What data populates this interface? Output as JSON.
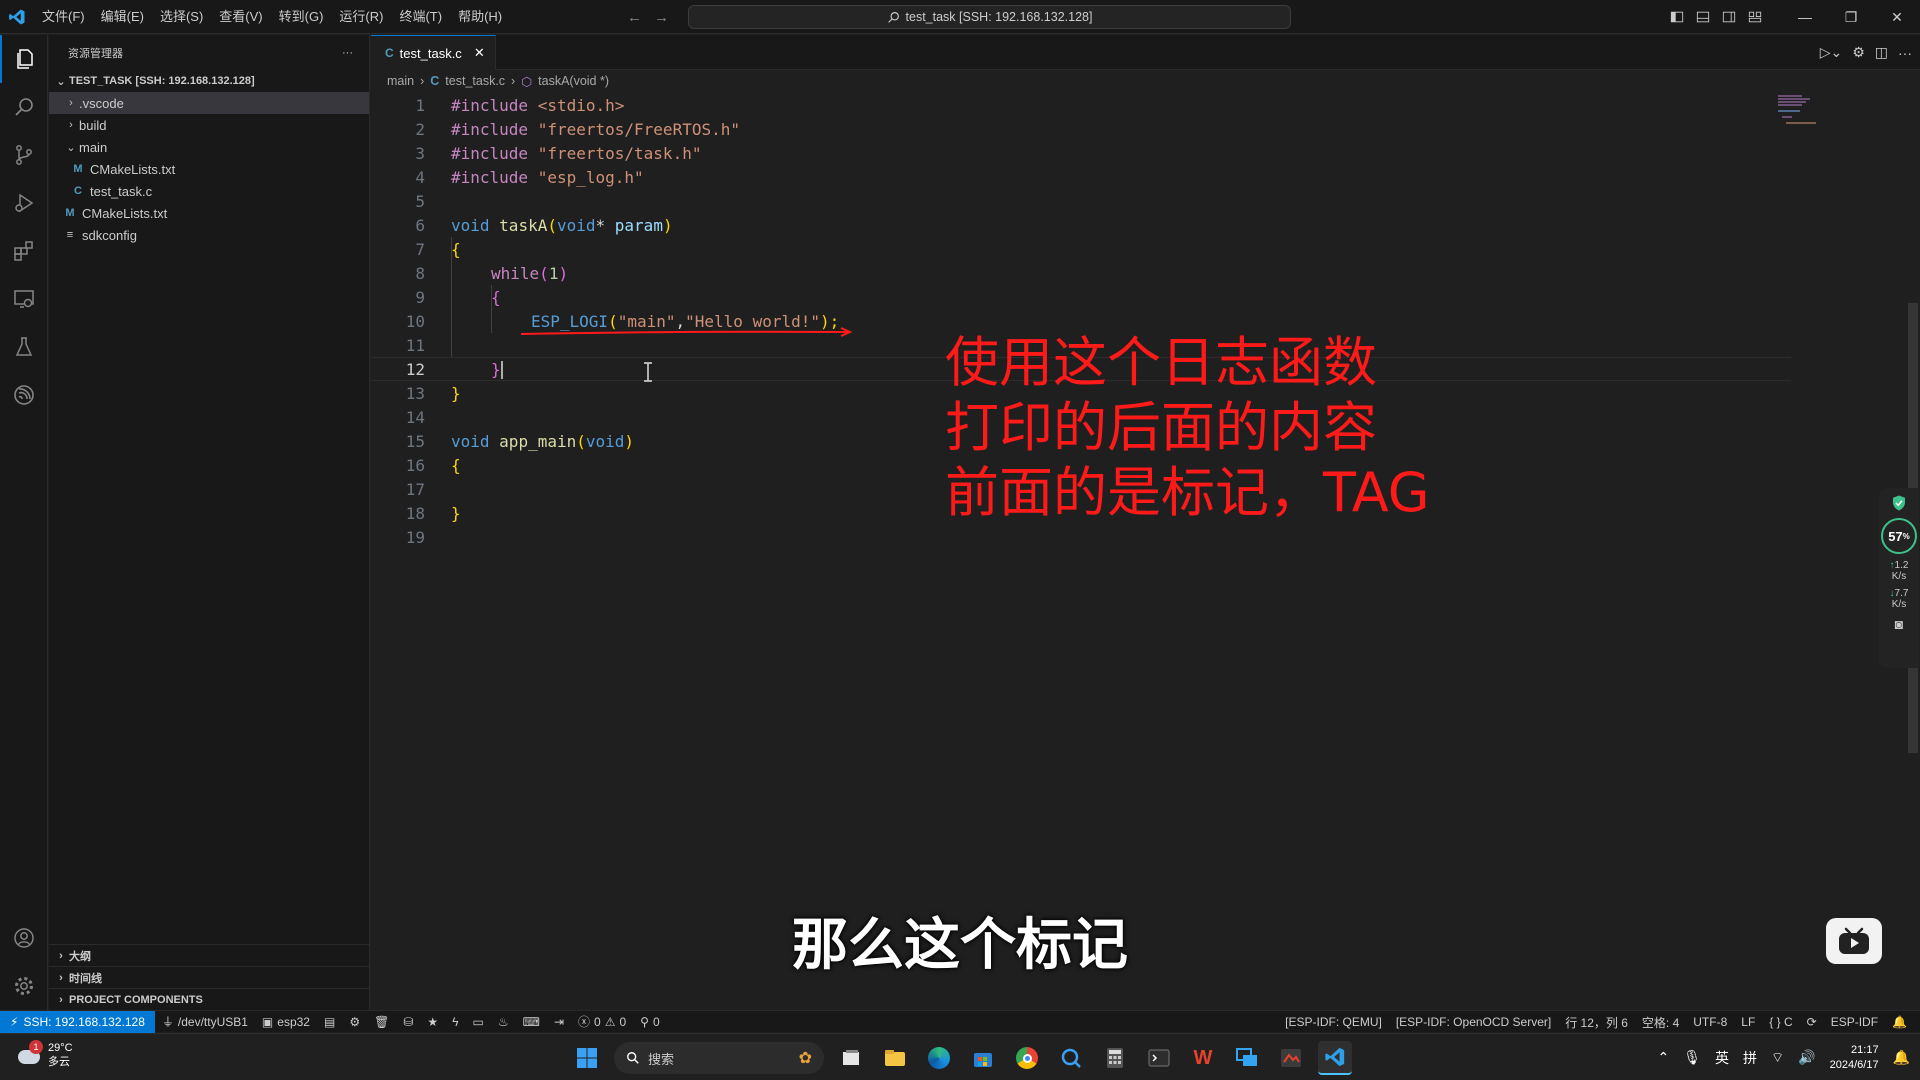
{
  "titlebar": {
    "menu": [
      "文件(F)",
      "编辑(E)",
      "选择(S)",
      "查看(V)",
      "转到(G)",
      "运行(R)",
      "终端(T)",
      "帮助(H)"
    ],
    "command_center": "test_task [SSH: 192.168.132.128]"
  },
  "sidebar": {
    "title": "资源管理器",
    "workspace": "TEST_TASK [SSH: 192.168.132.128]",
    "items": [
      {
        "label": ".vscode",
        "type": "folder"
      },
      {
        "label": "build",
        "type": "folder"
      },
      {
        "label": "main",
        "type": "folder-open"
      },
      {
        "label": "CMakeLists.txt",
        "type": "cmake"
      },
      {
        "label": "test_task.c",
        "type": "c"
      },
      {
        "label": "CMakeLists.txt",
        "type": "cmake"
      },
      {
        "label": "sdkconfig",
        "type": "config"
      }
    ],
    "bottom_sections": [
      "大纲",
      "时间线",
      "PROJECT COMPONENTS"
    ]
  },
  "editor": {
    "tab": "test_task.c",
    "breadcrumb": [
      "main",
      "test_task.c",
      "taskA(void *)"
    ],
    "line_numbers": [
      "1",
      "2",
      "3",
      "4",
      "5",
      "6",
      "7",
      "8",
      "9",
      "10",
      "11",
      "12",
      "13",
      "14",
      "15",
      "16",
      "17",
      "18",
      "19"
    ],
    "current_line": "12",
    "code": {
      "l1": [
        "#include",
        " ",
        "<stdio.h>"
      ],
      "l2": [
        "#include",
        " ",
        "\"freertos/FreeRTOS.h\""
      ],
      "l3": [
        "#include",
        " ",
        "\"freertos/task.h\""
      ],
      "l4": [
        "#include",
        " ",
        "\"esp_log.h\""
      ],
      "l6": [
        "void",
        " ",
        "taskA",
        "(",
        "void",
        "* ",
        "param",
        ")"
      ],
      "l7": "{",
      "l8": [
        "while",
        "(",
        "1",
        ")"
      ],
      "l9": "{",
      "l10": [
        "ESP_LOGI",
        "(",
        "\"main\"",
        ",",
        "\"Hello world!\"",
        ");"
      ],
      "l12": "}",
      "l13": "}",
      "l15": [
        "void",
        " ",
        "app_main",
        "(",
        "void",
        ")"
      ],
      "l16": "{",
      "l18": "}"
    }
  },
  "annotation": {
    "lines": [
      "使用这个日志函数",
      "打印的后面的内容",
      "前面的是标记，TAG"
    ],
    "color": "#ff1a1a"
  },
  "subtitle": "那么这个标记",
  "float_panel": {
    "percent": "57",
    "percent_unit": "%",
    "up": "1.2",
    "up_unit": "K/s",
    "down": "7.7",
    "down_unit": "K/s"
  },
  "statusbar": {
    "remote": "SSH: 192.168.132.128",
    "port": "/dev/ttyUSB1",
    "target": "esp32",
    "errors": "0",
    "warnings": "0",
    "ports": "0",
    "right": [
      "[ESP-IDF: QEMU]",
      "[ESP-IDF: OpenOCD Server]",
      "行 12，列 6",
      "空格: 4",
      "UTF-8",
      "LF",
      "{ } C",
      "ESP-IDF"
    ]
  },
  "taskbar": {
    "weather_temp": "29°C",
    "weather_desc": "多云",
    "weather_badge": "1",
    "search_placeholder": "搜索",
    "ime1": "英",
    "ime2": "拼",
    "time": "21:17",
    "date": "2024/6/17"
  },
  "colors": {
    "accent": "#0078d4",
    "annotation": "#ff1a1a"
  }
}
